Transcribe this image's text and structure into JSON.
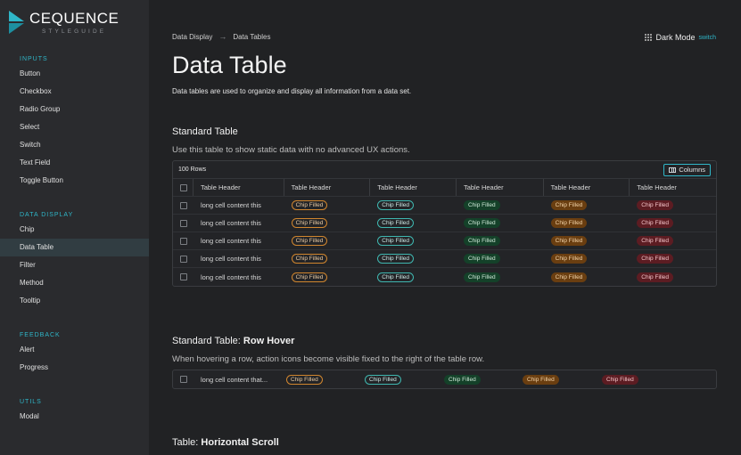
{
  "brand": {
    "name": "CEQUENCE",
    "sub": "STYLEGUIDE"
  },
  "colors": {
    "accent": "#2fb6c8",
    "sidebar_bg": "#2a2b2e",
    "page_bg": "#212224"
  },
  "sidebar": {
    "sections": [
      {
        "heading": "INPUTS",
        "items": [
          "Button",
          "Checkbox",
          "Radio Group",
          "Select",
          "Switch",
          "Text Field",
          "Toggle Button"
        ]
      },
      {
        "heading": "DATA DISPLAY",
        "items": [
          "Chip",
          "Data Table",
          "Filter",
          "Method",
          "Tooltip"
        ]
      },
      {
        "heading": "FEEDBACK",
        "items": [
          "Alert",
          "Progress"
        ]
      },
      {
        "heading": "UTILS",
        "items": [
          "Modal"
        ]
      }
    ],
    "active": "Data Table"
  },
  "breadcrumb": {
    "parent": "Data Display",
    "current": "Data Tables"
  },
  "darkmode": {
    "label": "Dark Mode",
    "toggle": "switch"
  },
  "page": {
    "title": "Data Table",
    "description": "Data tables are used to organize and display all information from a data set."
  },
  "standard": {
    "title": "Standard Table",
    "description": "Use this table to show static data with no advanced UX actions.",
    "row_count": "100 Rows",
    "columns_button": "Columns",
    "headers": [
      "Table Header",
      "Table Header",
      "Table Header",
      "Table Header",
      "Table Header",
      "Table Header"
    ],
    "cell_text": "long cell content this",
    "chip_label": "Chip Filled",
    "rows": 5
  },
  "hover": {
    "title_prefix": "Standard Table: ",
    "title_bold": "Row Hover",
    "description": "When hovering a row, action icons become visible fixed to the right of the table row.",
    "cell_text": "long cell content that...",
    "chip_label": "Chip Filled"
  },
  "scroll": {
    "title_prefix": "Table: ",
    "title_bold": "Horizontal Scroll"
  }
}
